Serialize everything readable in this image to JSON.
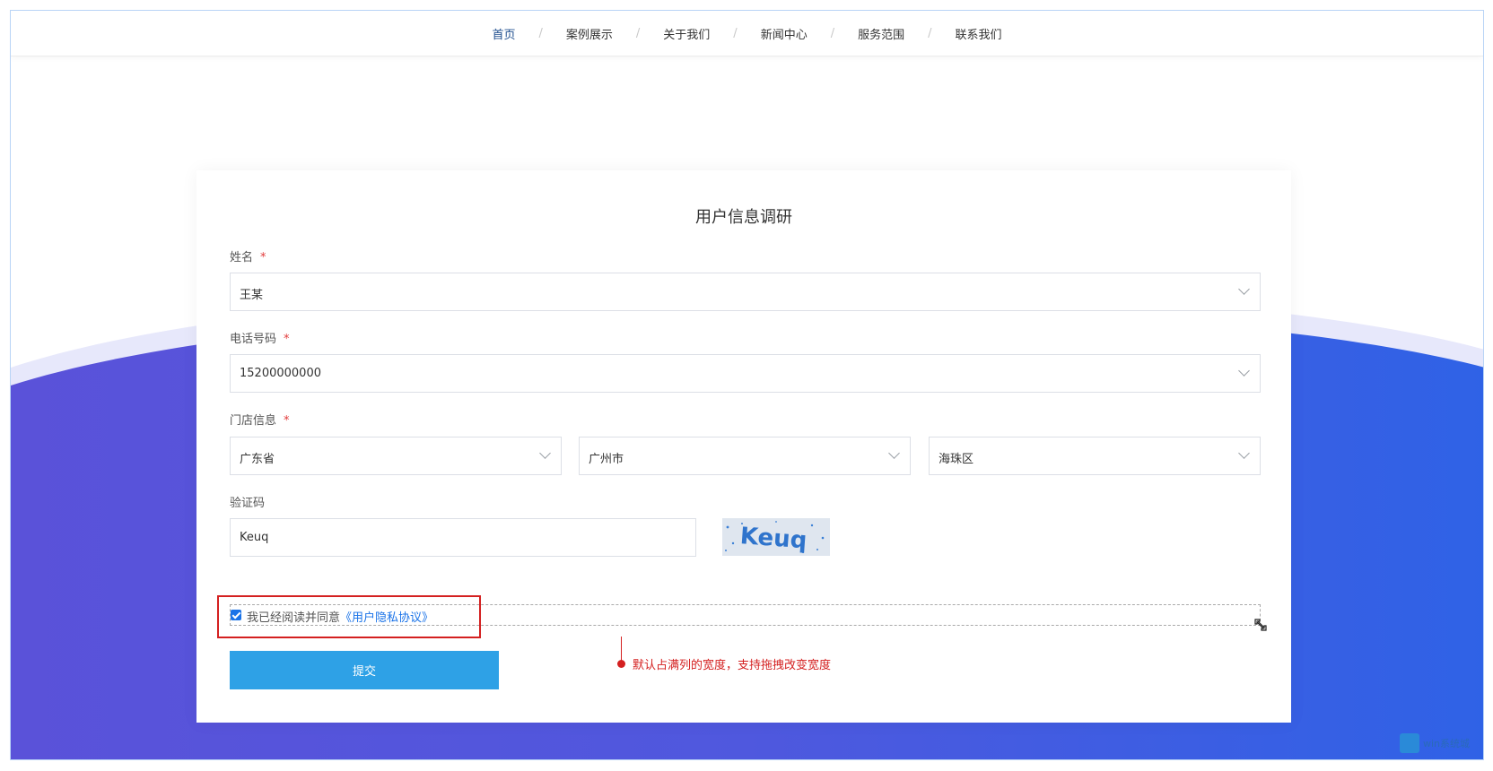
{
  "nav": {
    "items": [
      "首页",
      "案例展示",
      "关于我们",
      "新闻中心",
      "服务范围",
      "联系我们"
    ],
    "separator": "/",
    "active_index": 0
  },
  "form": {
    "title": "用户信息调研",
    "name_field": {
      "label": "姓名",
      "required_mark": "*",
      "value": "王某"
    },
    "phone_field": {
      "label": "电话号码",
      "required_mark": "*",
      "value": "15200000000"
    },
    "store_field": {
      "label": "门店信息",
      "required_mark": "*",
      "province": "广东省",
      "city": "广州市",
      "district": "海珠区"
    },
    "captcha_field": {
      "label": "验证码",
      "value": "Keuq",
      "image_text": "Keuq"
    },
    "agreement": {
      "text": "我已经阅读并同意",
      "link": "《用户隐私协议》",
      "checked": true
    },
    "submit_label": "提交"
  },
  "annotation": {
    "text": "默认占满列的宽度，支持拖拽改变宽度"
  },
  "watermark": {
    "text": "win系统城"
  },
  "colors": {
    "accent": "#1a73e8",
    "submit": "#2ea1e6",
    "annotation": "#d42020",
    "background_wave": "#4a5ce0",
    "required": "#e23b3b"
  },
  "icons": [
    "chevron-down-icon",
    "checkbox-icon",
    "resize-handle-icon",
    "watermark-logo-icon"
  ]
}
